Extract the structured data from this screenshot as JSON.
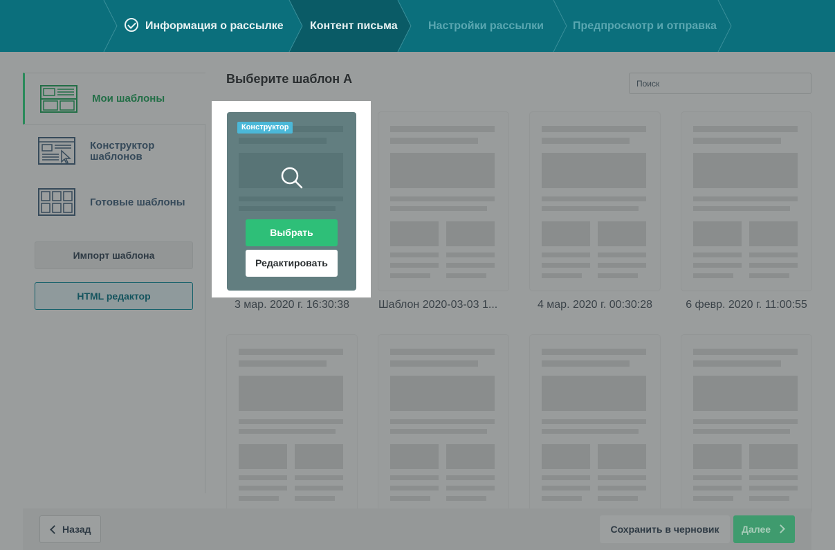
{
  "stepper": {
    "steps": [
      {
        "label": "Информация о рассылке",
        "state": "done"
      },
      {
        "label": "Контент письма",
        "state": "active"
      },
      {
        "label": "Настройки рассылки",
        "state": "todo"
      },
      {
        "label": "Предпросмотр и отправка",
        "state": "todo"
      }
    ]
  },
  "sidebar": {
    "items": [
      {
        "label": "Мои шаблоны",
        "icon": "my-templates-icon",
        "active": true
      },
      {
        "label": "Конструктор шаблонов",
        "icon": "template-builder-icon",
        "active": false
      },
      {
        "label": "Готовые шаблоны",
        "icon": "ready-templates-icon",
        "active": false
      }
    ],
    "import_label": "Импорт шаблона",
    "html_editor_label": "HTML редактор"
  },
  "main": {
    "title": "Выберите шаблон A",
    "search_placeholder": "Поиск",
    "highlight": {
      "badge": "Конструктор",
      "select_label": "Выбрать",
      "edit_label": "Редактировать"
    },
    "templates": [
      {
        "caption": "3 мар. 2020 г. 16:30:38"
      },
      {
        "caption": "Шаблон 2020-03-03 1..."
      },
      {
        "caption": "4 мар. 2020 г. 00:30:28"
      },
      {
        "caption": "6 февр. 2020 г. 11:00:55"
      }
    ]
  },
  "footer": {
    "back_label": "Назад",
    "draft_label": "Сохранить в черновик",
    "next_label": "Далее"
  },
  "colors": {
    "header": "#0b6f7c",
    "accent_green": "#2ebf78",
    "badge": "#4bb8d8"
  }
}
